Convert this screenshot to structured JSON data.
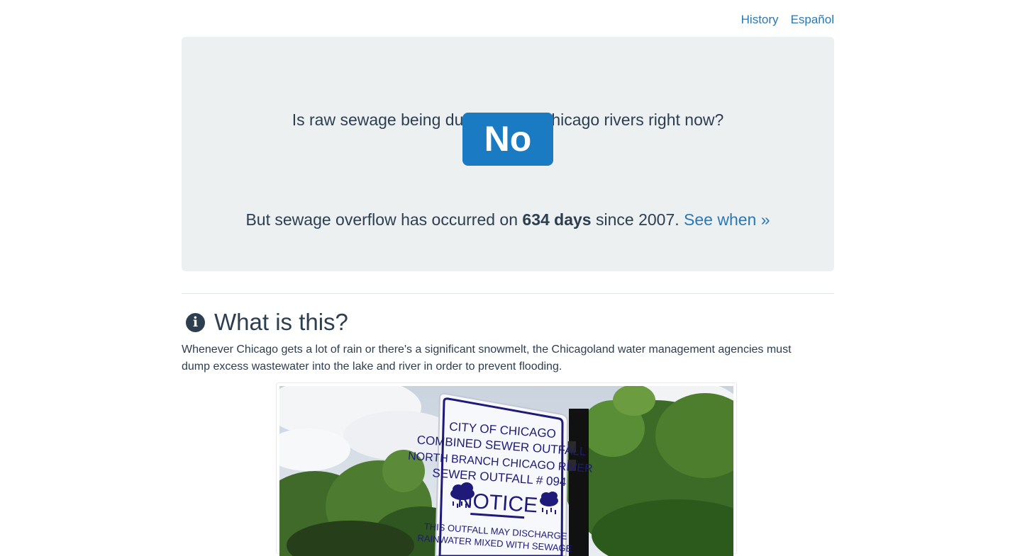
{
  "nav": {
    "history": "History",
    "spanish": "Español"
  },
  "status": {
    "question": "Is raw sewage being dumped into Chicago rivers right now?",
    "answer": "No",
    "answer_color": "#1a7bc2",
    "overflow_prefix": "But sewage overflow has occurred on ",
    "overflow_days": "634 days",
    "overflow_suffix": " since 2007. ",
    "see_when_link": "See when »"
  },
  "about": {
    "icon": "info-icon",
    "title": "What is this?",
    "description": "Whenever Chicago gets a lot of rain or there's a significant snowmelt, the Chicagoland water management agencies must dump excess wastewater into the lake and river in order to prevent flooding."
  },
  "photo": {
    "sign_lines": [
      "CITY OF CHICAGO",
      "COMBINED SEWER OUTFALL",
      "NORTH BRANCH CHICAGO RIVER",
      "SEWER OUTFALL # 094",
      "NOTICE",
      "THIS OUTFALL MAY DISCHARGE",
      "RAINWATER MIXED WITH SEWAGE"
    ]
  },
  "colors": {
    "link": "#2a78b4",
    "text": "#2c3e50",
    "hero_bg": "#ecf0f1",
    "sign_text": "#1f1a7a"
  }
}
